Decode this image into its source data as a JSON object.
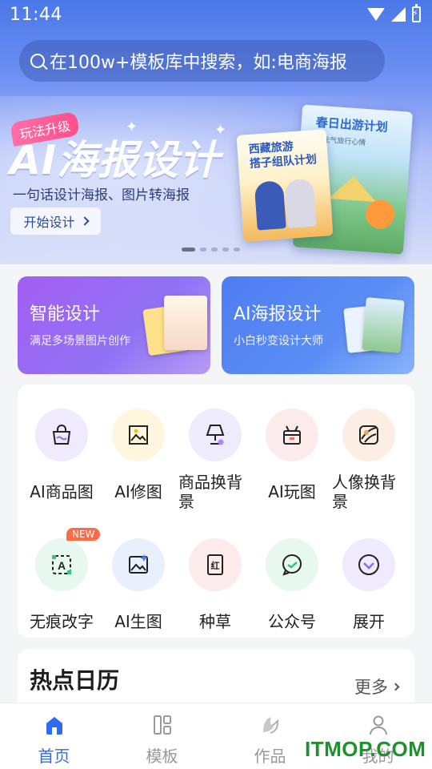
{
  "status_bar": {
    "time": "11:44"
  },
  "search": {
    "placeholder": "在100w+模板库中搜索，如:电商海报"
  },
  "banner": {
    "badge": "玩法升级",
    "title": "AI海报设计",
    "subtitle": "一句话设计海报、图片转海报",
    "button_label": "开始设计",
    "poster_left_title": "西藏旅游",
    "poster_left_title2": "搭子组队计划",
    "poster_right_title": "春日出游计划",
    "poster_right_caption": "开启元气旅行心情",
    "pager_count": 5,
    "pager_active": 1
  },
  "feature_cards": [
    {
      "title": "智能设计",
      "subtitle": "满足多场景图片创作"
    },
    {
      "title": "AI海报设计",
      "subtitle": "小白秒变设计大师"
    }
  ],
  "tools": [
    {
      "label": "AI商品图",
      "icon": "shopping-bag-icon",
      "bg": "#efeafd"
    },
    {
      "label": "AI修图",
      "icon": "image-crop-icon",
      "bg": "#fff6de"
    },
    {
      "label": "商品换背景",
      "icon": "lamp-icon",
      "bg": "#eeebfd"
    },
    {
      "label": "AI玩图",
      "icon": "gift-box-icon",
      "bg": "#fdeaea"
    },
    {
      "label": "人像换背景",
      "icon": "portrait-icon",
      "bg": "#fdeee3"
    },
    {
      "label": "无痕改字",
      "icon": "text-edit-icon",
      "bg": "#e7f8ee",
      "badge": "NEW"
    },
    {
      "label": "AI生图",
      "icon": "ai-image-icon",
      "bg": "#e8f0fd"
    },
    {
      "label": "种草",
      "icon": "note-icon",
      "bg": "#fdeaea"
    },
    {
      "label": "公众号",
      "icon": "chat-bubble-icon",
      "bg": "#e7f8ee"
    },
    {
      "label": "展开",
      "icon": "expand-icon",
      "bg": "#efeafd"
    }
  ],
  "hot_calendar": {
    "title": "热点日历",
    "more_label": "更多"
  },
  "tabs": [
    {
      "label": "首页",
      "icon": "home-icon",
      "active": true
    },
    {
      "label": "模板",
      "icon": "template-icon",
      "active": false
    },
    {
      "label": "作品",
      "icon": "works-icon",
      "active": false
    },
    {
      "label": "我的",
      "icon": "profile-icon",
      "active": false
    }
  ],
  "watermark": "ITMOP.COM",
  "colors": {
    "accent": "#2f6bf0",
    "banner_top": "#4a78e8",
    "card_purple": "#a45df2",
    "card_blue": "#4f7df1"
  }
}
